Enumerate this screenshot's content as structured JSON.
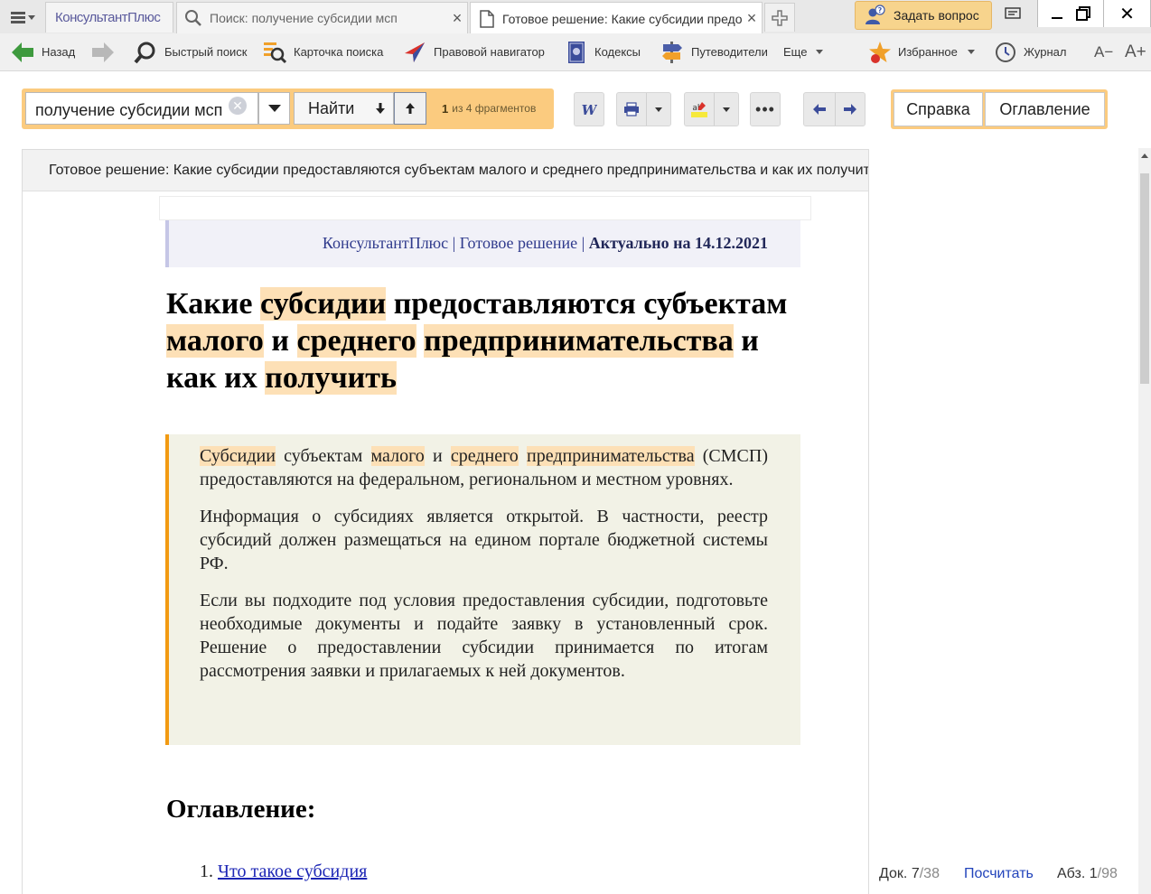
{
  "tabbar": {
    "brand": "КонсультантПлюс",
    "tabs": [
      {
        "label": "Поиск: получение субсидии мсп"
      },
      {
        "label": "Готовое решение: Какие субсидии предоставляются"
      }
    ],
    "ask_button": "Задать вопрос"
  },
  "toolbar": {
    "back": "Назад",
    "quick_search": "Быстрый поиск",
    "search_card": "Карточка поиска",
    "legal_navigator": "Правовой навигатор",
    "codes": "Кодексы",
    "guides": "Путеводители",
    "more": "Еще",
    "favorites": "Избранное",
    "journal": "Журнал",
    "font_smaller": "A−",
    "font_larger": "A+"
  },
  "search": {
    "query": "получение субсидии мсп",
    "find_label": "Найти",
    "count_current": "1",
    "count_text": "из 4 фрагментов"
  },
  "help": {
    "help_label": "Справка",
    "toc_label": "Оглавление"
  },
  "document": {
    "header": "Готовое решение: Какие субсидии предоставляются субъектам малого и среднего предпринимательства и как их получить",
    "banner_source": "КонсультантПлюс | Готовое решение | ",
    "banner_actual": "Актуально на 14.12.2021",
    "title": {
      "w1": "Какие ",
      "h1": "субсидии",
      "w2": " предоставляются субъектам ",
      "h2": "малого",
      "w3": " и ",
      "h3": "среднего",
      "w4": " ",
      "h4": "предпринимательства",
      "w5": " и как их ",
      "h5": "получить"
    },
    "summary": {
      "p1_h1": "Субсидии",
      "p1_t1": " субъектам ",
      "p1_h2": "малого",
      "p1_t2": " и ",
      "p1_h3": "среднего",
      "p1_t3": " ",
      "p1_h4": "предпринимательства",
      "p1_t4": " (СМСП) предоставляются на федеральном, региональном и местном уровнях.",
      "p2": "Информация о субсидиях является открытой. В частности, реестр субсидий должен размещаться на едином портале бюджетной системы РФ.",
      "p3": "Если вы подходите под условия предоставления субсидии, подготовьте необходимые документы и подайте заявку в установленный срок. Решение о предоставлении субсидии принимается по итогам рассмотрения заявки и прилагаемых к ней документов."
    },
    "toc_heading": "Оглавление:",
    "toc_items": [
      {
        "num": "1.",
        "label": "Что такое субсидия"
      }
    ]
  },
  "status": {
    "doc_label": "Док. ",
    "doc_current": "7",
    "doc_total": "/38",
    "count_link": "Посчитать",
    "para_label": "Абз. ",
    "para_current": "1",
    "para_total": "/98"
  },
  "colors": {
    "highlight": "#fde0b6",
    "search_accent": "#fbcb7f",
    "summary_border": "#f29a12",
    "link": "#1c26b5"
  }
}
